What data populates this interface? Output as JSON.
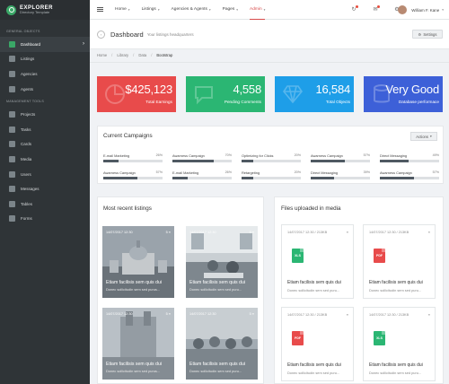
{
  "brand": {
    "name": "EXPLORER",
    "subtitle": "Directory Template"
  },
  "sidebar": {
    "section_general": "GENERAL OBJECTS",
    "section_management": "MANAGEMENT TOOLS",
    "general_items": [
      {
        "label": "Dashboard",
        "icon": "dashboard-icon"
      },
      {
        "label": "Listings",
        "icon": "list-icon"
      },
      {
        "label": "Agencies",
        "icon": "building-icon"
      },
      {
        "label": "Agents",
        "icon": "user-icon"
      }
    ],
    "management_items": [
      {
        "label": "Projects",
        "icon": "folder-icon"
      },
      {
        "label": "Tasks",
        "icon": "tasks-icon"
      },
      {
        "label": "Cards",
        "icon": "cards-icon"
      },
      {
        "label": "Media",
        "icon": "media-icon"
      },
      {
        "label": "Users",
        "icon": "users-icon"
      },
      {
        "label": "Messages",
        "icon": "mail-icon"
      },
      {
        "label": "Tables",
        "icon": "table-icon"
      },
      {
        "label": "Forms",
        "icon": "forms-icon"
      }
    ]
  },
  "topnav": {
    "items": [
      "Home",
      "Listings",
      "Agencies & Agents",
      "Pages",
      "Admin"
    ],
    "user_name": "William F. Kane"
  },
  "header": {
    "title": "Dashboard",
    "subtitle": "Your listings headquarters",
    "settings_label": "Settings"
  },
  "breadcrumb": [
    "Home",
    "Library",
    "Data",
    "Bootstrap"
  ],
  "stats": [
    {
      "value": "$425,123",
      "label": "Total Earnings",
      "color": "#e84b4b"
    },
    {
      "value": "4,558",
      "label": "Pending Comments",
      "color": "#2bb673"
    },
    {
      "value": "16,584",
      "label": "Total Objects",
      "color": "#1e9ee8"
    },
    {
      "value": "Very Good",
      "label": "Database performace",
      "color": "#3d60d8"
    }
  ],
  "campaigns": {
    "title": "Current Campaigns",
    "actions_label": "Actions",
    "items": [
      {
        "name": "E-mail Marketing",
        "pct": "26%",
        "value": 26
      },
      {
        "name": "Awarness Campaign",
        "pct": "70%",
        "value": 70
      },
      {
        "name": "Optimizing for Clicks",
        "pct": "20%",
        "value": 20
      },
      {
        "name": "Awarness Campaign",
        "pct": "57%",
        "value": 57
      },
      {
        "name": "Direct Messaging",
        "pct": "49%",
        "value": 49
      },
      {
        "name": "Awarness Campaign",
        "pct": "57%",
        "value": 57
      },
      {
        "name": "E-mail Marketing",
        "pct": "26%",
        "value": 26
      },
      {
        "name": "Retargeting",
        "pct": "20%",
        "value": 20
      },
      {
        "name": "Direct Messaging",
        "pct": "39%",
        "value": 39
      },
      {
        "name": "Awarness Campaign",
        "pct": "57%",
        "value": 57
      }
    ]
  },
  "listings": {
    "title": "Most recent listings",
    "cards": [
      {
        "date": "14/07/2017 12:30",
        "menu": "5 ≡",
        "title": "Etiam facilisis sem quis dui",
        "sub": "Donec sollicitudin sem sed purus..."
      },
      {
        "date": "14/07/2017 12:30",
        "menu": "5 ≡",
        "title": "Etiam facilisis sem quis dui",
        "sub": "Donec sollicitudin sem sed puru..."
      },
      {
        "date": "14/07/2017 12:30",
        "menu": "5 ≡",
        "title": "Etiam facilisis sem quis dui",
        "sub": "Donec sollicitudin sem sed purus..."
      },
      {
        "date": "14/07/2017 12:30",
        "menu": "5 ≡",
        "title": "Etiam facilisis sem quis dui",
        "sub": "Donec sollicitudin sem sed puru..."
      }
    ]
  },
  "files": {
    "title": "Files uploaded in media",
    "cards": [
      {
        "date": "14/07/2017 12:30 / 213KB",
        "menu": "≡",
        "type": "XLS",
        "color": "#2bb673",
        "title": "Etiam facilisis sem quis dui",
        "sub": "Donec sollicitudin sem sed puru..."
      },
      {
        "date": "14/07/2017 12:30 / 213KB",
        "menu": "≡",
        "type": "PDF",
        "color": "#e84b4b",
        "title": "Etiam facilisis sem quis dui",
        "sub": "Donec sollicitudin sem sed puru..."
      },
      {
        "date": "14/07/2017 12:30 / 213KB",
        "menu": "≡",
        "type": "PDF",
        "color": "#e84b4b",
        "title": "Etiam facilisis sem quis dui",
        "sub": "Donec sollicitudin sem sed puru..."
      },
      {
        "date": "14/07/2017 12:30 / 213KB",
        "menu": "≡",
        "type": "XLS",
        "color": "#2bb673",
        "title": "Etiam facilisis sem quis dui",
        "sub": "Donec sollicitudin sem sed puru..."
      }
    ]
  }
}
